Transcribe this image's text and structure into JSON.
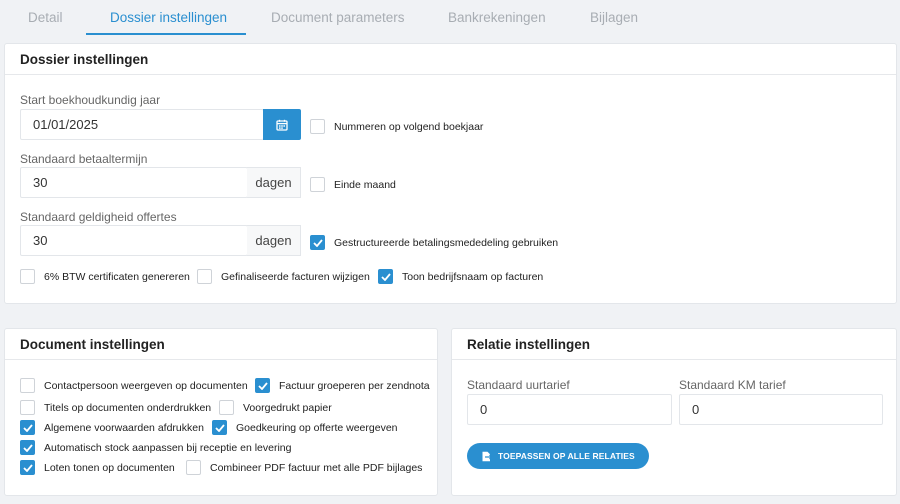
{
  "tabs": [
    {
      "label": "Detail"
    },
    {
      "label": "Dossier instellingen"
    },
    {
      "label": "Document parameters"
    },
    {
      "label": "Bankrekeningen"
    },
    {
      "label": "Bijlagen"
    }
  ],
  "dossier": {
    "title": "Dossier instellingen",
    "start_label": "Start boekhoudkundig jaar",
    "start_value": "01/01/2025",
    "payment_label": "Standaard betaaltermijn",
    "payment_value": "30",
    "payment_unit": "dagen",
    "validity_label": "Standaard geldigheid offertes",
    "validity_value": "30",
    "validity_unit": "dagen",
    "checkboxes": {
      "numbering": {
        "label": "Nummeren op volgend boekjaar",
        "checked": false
      },
      "end_month": {
        "label": "Einde maand",
        "checked": false
      },
      "structured": {
        "label": "Gestructureerde betalingsmededeling gebruiken",
        "checked": true
      },
      "vat6": {
        "label": "6% BTW certificaten genereren",
        "checked": false
      },
      "finalized": {
        "label": "Gefinaliseerde facturen wijzigen",
        "checked": false
      },
      "company_name": {
        "label": "Toon bedrijfsnaam op facturen",
        "checked": true
      }
    }
  },
  "document": {
    "title": "Document instellingen",
    "checkboxes": {
      "contact": {
        "label": "Contactpersoon weergeven op documenten",
        "checked": false
      },
      "group_invoice": {
        "label": "Factuur groeperen per zendnota",
        "checked": true
      },
      "suppress_titles": {
        "label": "Titels op documenten onderdrukken",
        "checked": false
      },
      "preprinted": {
        "label": "Voorgedrukt papier",
        "checked": false
      },
      "terms": {
        "label": "Algemene voorwaarden afdrukken",
        "checked": true
      },
      "approval": {
        "label": "Goedkeuring op offerte weergeven",
        "checked": true
      },
      "stock": {
        "label": "Automatisch stock aanpassen bij receptie en levering",
        "checked": true
      },
      "lots": {
        "label": "Loten tonen op documenten",
        "checked": true
      },
      "combine_pdf": {
        "label": "Combineer PDF factuur met alle PDF bijlages",
        "checked": false
      }
    }
  },
  "relatie": {
    "title": "Relatie instellingen",
    "hourly_label": "Standaard uurtarief",
    "hourly_value": "0",
    "km_label": "Standaard KM tarief",
    "km_value": "0",
    "apply_label": "TOEPASSEN OP ALLE RELATIES"
  },
  "colors": {
    "accent": "#2a8fd0",
    "background": "#f0f2f5"
  },
  "icons": {
    "calendar": "calendar-icon",
    "check": "check-icon",
    "apply": "apply-icon"
  }
}
